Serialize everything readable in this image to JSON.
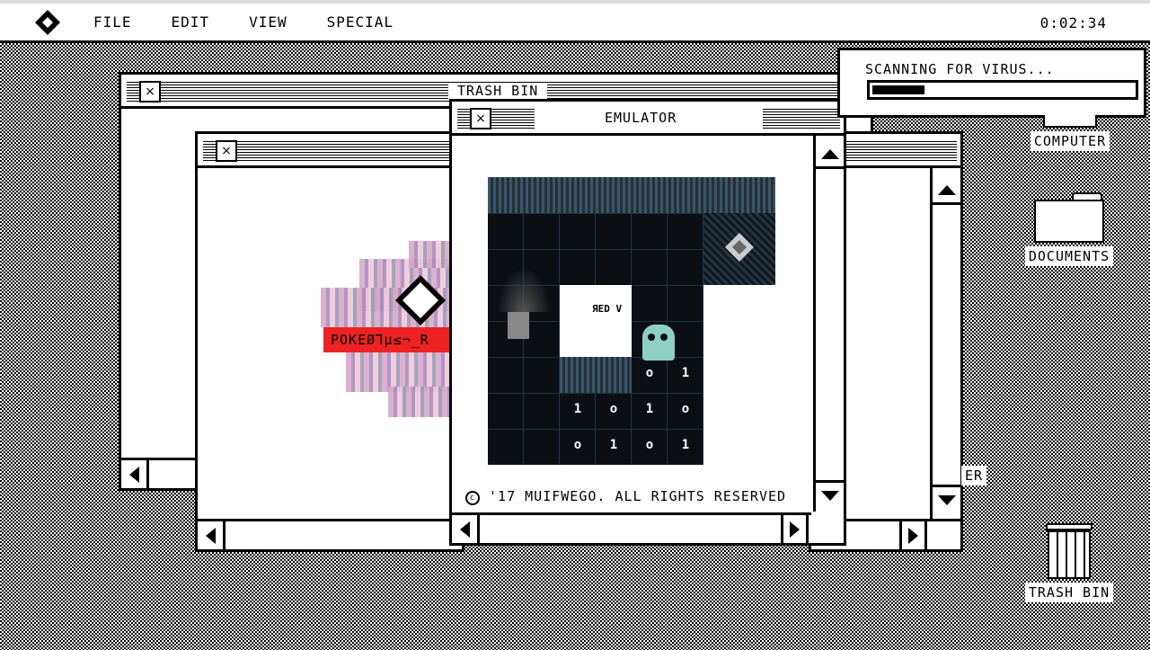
{
  "menubar": {
    "logo": "diamond-logo",
    "items": [
      "FILE",
      "EDIT",
      "VIEW",
      "SPECIAL"
    ],
    "clock": "0:02:34"
  },
  "windows": {
    "trash_bin": {
      "title": "TRASH BIN",
      "close": "×"
    },
    "back_window": {
      "close": "×",
      "glitch_label": "POKEØ⅂µ≤¬_R"
    },
    "emulator": {
      "title": "EMULATOR",
      "close": "×",
      "game_text": "ЯED V",
      "bits": [
        "o",
        "1",
        "1",
        "o",
        "1",
        "o",
        "o",
        "1",
        "o",
        "1"
      ],
      "copyright": "'17 MUIFWEGO. ALL RIGHTS RESERVED"
    },
    "right_window": {
      "partial_label": "ER"
    }
  },
  "scanner": {
    "text": "SCANNING FOR VIRUS...",
    "progress": 0.2
  },
  "desktop_icons": {
    "computer": "COMPUTER",
    "documents": "DOCUMENTS",
    "trash": "TRASH BIN"
  },
  "colors": {
    "glitch_red": "#ee2222",
    "game_bg": "#0b0f14",
    "ghost": "#8fd1c1"
  }
}
